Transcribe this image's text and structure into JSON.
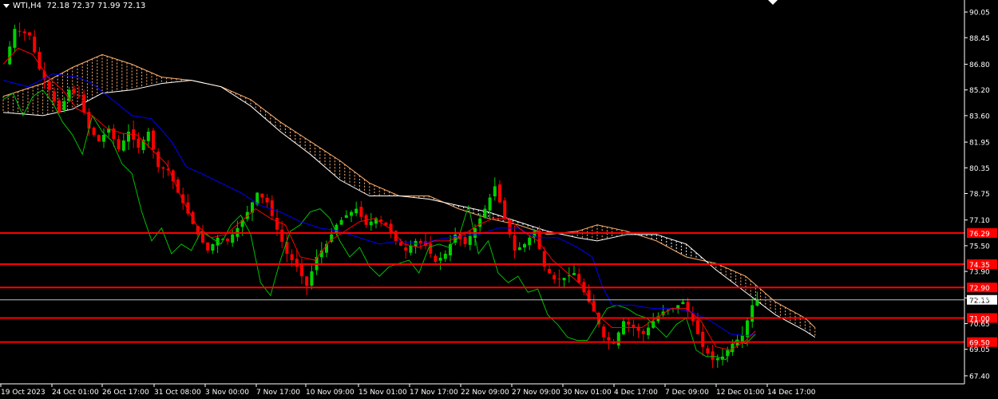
{
  "symbol": "WTI,H4",
  "ohlc": "72.18 72.37 71.99 72.13",
  "colors": {
    "background": "#000000",
    "bull": "#00d000",
    "bear": "#ff0000",
    "tenkan": "#ff0000",
    "kijun": "#0000ff",
    "chikou": "#00c000",
    "kumo_down": "#ffffff",
    "kumo_up": "#ffb070",
    "level": "#ff0000",
    "axis": "#ffffff",
    "price_line": "#c0c0c0"
  },
  "chart_data": {
    "type": "candlestick",
    "instrument": "WTI",
    "timeframe": "H4",
    "ylim": [
      66.9,
      90.6
    ],
    "y_ticks": [
      "90.05",
      "88.45",
      "86.80",
      "85.20",
      "83.60",
      "81.95",
      "80.35",
      "78.75",
      "77.10",
      "75.50",
      "73.90",
      "72.25",
      "70.65",
      "69.05",
      "67.40"
    ],
    "x_ticks": [
      "19 Oct 2023",
      "24 Oct 01:00",
      "26 Oct 17:00",
      "31 Oct 08:00",
      "3 Nov 00:00",
      "7 Nov 17:00",
      "10 Nov 09:00",
      "15 Nov 01:00",
      "17 Nov 17:00",
      "22 Nov 09:00",
      "27 Nov 09:00",
      "30 Nov 01:00",
      "4 Dec 17:00",
      "7 Dec 09:00",
      "12 Dec 01:00",
      "14 Dec 17:00"
    ],
    "price_path": [
      [
        0,
        86.8
      ],
      [
        2,
        89.0
      ],
      [
        5,
        88.6
      ],
      [
        7,
        86.5
      ],
      [
        9,
        85.2
      ],
      [
        11,
        83.8
      ],
      [
        13,
        85.2
      ],
      [
        15,
        84.8
      ],
      [
        17,
        82.8
      ],
      [
        19,
        82.0
      ],
      [
        21,
        82.8
      ],
      [
        23,
        81.5
      ],
      [
        25,
        82.6
      ],
      [
        27,
        81.6
      ],
      [
        29,
        82.6
      ],
      [
        31,
        80.4
      ],
      [
        33,
        80.2
      ],
      [
        35,
        78.8
      ],
      [
        37,
        77.5
      ],
      [
        39,
        76.2
      ],
      [
        41,
        75.2
      ],
      [
        43,
        76.0
      ],
      [
        45,
        75.8
      ],
      [
        47,
        76.6
      ],
      [
        49,
        77.6
      ],
      [
        51,
        78.8
      ],
      [
        53,
        78.2
      ],
      [
        55,
        76.5
      ],
      [
        57,
        75.0
      ],
      [
        59,
        74.2
      ],
      [
        61,
        73.0
      ],
      [
        63,
        74.8
      ],
      [
        65,
        75.6
      ],
      [
        67,
        76.8
      ],
      [
        69,
        77.4
      ],
      [
        71,
        77.8
      ],
      [
        73,
        76.8
      ],
      [
        75,
        77.2
      ],
      [
        77,
        76.8
      ],
      [
        79,
        75.8
      ],
      [
        81,
        75.2
      ],
      [
        83,
        75.8
      ],
      [
        85,
        75.5
      ],
      [
        87,
        74.5
      ],
      [
        89,
        75.0
      ],
      [
        91,
        76.2
      ],
      [
        93,
        75.6
      ],
      [
        95,
        76.6
      ],
      [
        97,
        77.8
      ],
      [
        99,
        79.2
      ],
      [
        101,
        77.2
      ],
      [
        103,
        75.2
      ],
      [
        105,
        75.6
      ],
      [
        107,
        76.4
      ],
      [
        109,
        74.2
      ],
      [
        111,
        73.4
      ],
      [
        113,
        73.5
      ],
      [
        115,
        73.8
      ],
      [
        117,
        72.6
      ],
      [
        119,
        71.4
      ],
      [
        121,
        69.8
      ],
      [
        123,
        69.4
      ],
      [
        125,
        70.8
      ],
      [
        127,
        70.4
      ],
      [
        129,
        70.0
      ],
      [
        131,
        70.8
      ],
      [
        133,
        71.4
      ],
      [
        135,
        71.6
      ],
      [
        137,
        72.0
      ],
      [
        139,
        70.8
      ],
      [
        141,
        69.2
      ],
      [
        143,
        68.4
      ],
      [
        145,
        68.6
      ],
      [
        147,
        69.4
      ],
      [
        149,
        69.9
      ],
      [
        151,
        71.8
      ],
      [
        152,
        72.13
      ]
    ],
    "tenkan": [
      [
        0,
        86.8
      ],
      [
        3,
        87.8
      ],
      [
        6,
        87.4
      ],
      [
        9,
        86.0
      ],
      [
        12,
        85.2
      ],
      [
        15,
        84.0
      ],
      [
        18,
        83.6
      ],
      [
        21,
        82.8
      ],
      [
        24,
        82.5
      ],
      [
        27,
        82.4
      ],
      [
        30,
        81.5
      ],
      [
        33,
        80.6
      ],
      [
        36,
        78.5
      ],
      [
        39,
        76.8
      ],
      [
        42,
        76.0
      ],
      [
        45,
        76.2
      ],
      [
        48,
        77.0
      ],
      [
        51,
        77.8
      ],
      [
        54,
        77.2
      ],
      [
        57,
        76.8
      ],
      [
        60,
        74.8
      ],
      [
        63,
        74.6
      ],
      [
        66,
        75.8
      ],
      [
        69,
        76.4
      ],
      [
        72,
        77.0
      ],
      [
        75,
        77.2
      ],
      [
        78,
        76.6
      ],
      [
        81,
        75.6
      ],
      [
        84,
        75.4
      ],
      [
        87,
        75.8
      ],
      [
        90,
        75.8
      ],
      [
        93,
        76.2
      ],
      [
        96,
        76.8
      ],
      [
        99,
        77.2
      ],
      [
        102,
        77.2
      ],
      [
        105,
        76.4
      ],
      [
        108,
        75.8
      ],
      [
        111,
        74.6
      ],
      [
        114,
        73.8
      ],
      [
        117,
        73.0
      ],
      [
        120,
        71.2
      ],
      [
        123,
        70.4
      ],
      [
        126,
        70.4
      ],
      [
        129,
        70.4
      ],
      [
        132,
        71.0
      ],
      [
        135,
        71.6
      ],
      [
        138,
        71.6
      ],
      [
        141,
        70.8
      ],
      [
        144,
        69.2
      ],
      [
        147,
        69.0
      ],
      [
        150,
        69.6
      ],
      [
        152,
        70.2
      ]
    ],
    "kijun": [
      [
        0,
        85.8
      ],
      [
        5,
        85.4
      ],
      [
        10,
        86.2
      ],
      [
        15,
        86.0
      ],
      [
        18,
        85.6
      ],
      [
        22,
        84.6
      ],
      [
        26,
        83.6
      ],
      [
        30,
        83.4
      ],
      [
        34,
        82.0
      ],
      [
        37,
        80.4
      ],
      [
        40,
        80.0
      ],
      [
        44,
        79.4
      ],
      [
        48,
        78.8
      ],
      [
        52,
        78.0
      ],
      [
        56,
        77.6
      ],
      [
        60,
        77.0
      ],
      [
        64,
        76.6
      ],
      [
        68,
        76.4
      ],
      [
        72,
        76.0
      ],
      [
        76,
        75.6
      ],
      [
        80,
        75.8
      ],
      [
        84,
        75.6
      ],
      [
        88,
        75.9
      ],
      [
        92,
        76.1
      ],
      [
        96,
        76.2
      ],
      [
        100,
        76.6
      ],
      [
        104,
        76.6
      ],
      [
        108,
        76.0
      ],
      [
        112,
        76.0
      ],
      [
        116,
        75.4
      ],
      [
        119,
        74.8
      ],
      [
        121,
        73.0
      ],
      [
        123,
        71.8
      ],
      [
        127,
        71.8
      ],
      [
        131,
        71.6
      ],
      [
        135,
        71.6
      ],
      [
        139,
        71.4
      ],
      [
        143,
        70.8
      ],
      [
        147,
        70.0
      ],
      [
        150,
        69.9
      ],
      [
        152,
        70.0
      ]
    ],
    "chikou": [
      [
        0,
        84.6
      ],
      [
        2,
        85.0
      ],
      [
        4,
        83.6
      ],
      [
        6,
        84.8
      ],
      [
        8,
        85.2
      ],
      [
        10,
        84.4
      ],
      [
        12,
        83.2
      ],
      [
        14,
        82.4
      ],
      [
        16,
        81.2
      ],
      [
        18,
        83.6
      ],
      [
        20,
        82.6
      ],
      [
        22,
        82.0
      ],
      [
        24,
        80.6
      ],
      [
        26,
        80.0
      ],
      [
        28,
        77.6
      ],
      [
        30,
        75.8
      ],
      [
        32,
        76.6
      ],
      [
        34,
        75.0
      ],
      [
        36,
        75.6
      ],
      [
        38,
        75.2
      ],
      [
        40,
        76.4
      ],
      [
        42,
        76.0
      ],
      [
        44,
        75.6
      ],
      [
        46,
        76.8
      ],
      [
        48,
        77.4
      ],
      [
        50,
        76.2
      ],
      [
        52,
        73.2
      ],
      [
        54,
        72.4
      ],
      [
        56,
        74.6
      ],
      [
        58,
        76.4
      ],
      [
        60,
        76.8
      ],
      [
        62,
        77.6
      ],
      [
        64,
        77.8
      ],
      [
        66,
        77.2
      ],
      [
        68,
        75.8
      ],
      [
        70,
        74.8
      ],
      [
        72,
        75.4
      ],
      [
        74,
        74.2
      ],
      [
        76,
        73.6
      ],
      [
        78,
        74.2
      ],
      [
        80,
        74.4
      ],
      [
        82,
        74.6
      ],
      [
        84,
        73.8
      ],
      [
        86,
        75.4
      ],
      [
        88,
        75.6
      ],
      [
        90,
        75.4
      ],
      [
        92,
        76.0
      ],
      [
        94,
        78.0
      ],
      [
        96,
        75.0
      ],
      [
        98,
        75.8
      ],
      [
        100,
        73.8
      ],
      [
        102,
        73.2
      ],
      [
        104,
        73.6
      ],
      [
        106,
        72.6
      ],
      [
        108,
        72.8
      ],
      [
        110,
        71.2
      ],
      [
        112,
        70.6
      ],
      [
        114,
        69.8
      ],
      [
        116,
        69.6
      ],
      [
        118,
        69.6
      ],
      [
        120,
        70.6
      ],
      [
        122,
        71.6
      ],
      [
        124,
        71.8
      ],
      [
        126,
        71.6
      ],
      [
        128,
        71.2
      ],
      [
        130,
        71.0
      ],
      [
        132,
        70.4
      ],
      [
        134,
        69.8
      ],
      [
        136,
        70.6
      ],
      [
        138,
        71.0
      ],
      [
        140,
        69.0
      ],
      [
        142,
        68.6
      ],
      [
        144,
        68.6
      ],
      [
        146,
        68.4
      ],
      [
        148,
        69.6
      ],
      [
        150,
        69.4
      ],
      [
        152,
        70.0
      ]
    ],
    "span_a": [
      [
        0,
        84.8
      ],
      [
        8,
        85.6
      ],
      [
        14,
        86.6
      ],
      [
        20,
        87.4
      ],
      [
        26,
        86.8
      ],
      [
        32,
        86.0
      ],
      [
        38,
        85.8
      ],
      [
        44,
        85.4
      ],
      [
        50,
        84.6
      ],
      [
        56,
        83.2
      ],
      [
        62,
        82.0
      ],
      [
        68,
        80.8
      ],
      [
        74,
        79.4
      ],
      [
        80,
        78.6
      ],
      [
        86,
        78.6
      ],
      [
        92,
        77.8
      ],
      [
        98,
        77.2
      ],
      [
        104,
        76.8
      ],
      [
        110,
        76.2
      ],
      [
        116,
        76.4
      ],
      [
        120,
        76.8
      ],
      [
        126,
        76.4
      ],
      [
        132,
        75.8
      ],
      [
        138,
        74.8
      ],
      [
        144,
        74.4
      ],
      [
        150,
        73.6
      ],
      [
        156,
        72.0
      ],
      [
        162,
        71.0
      ],
      [
        164,
        70.4
      ]
    ],
    "span_b": [
      [
        0,
        83.8
      ],
      [
        8,
        83.6
      ],
      [
        14,
        84.0
      ],
      [
        20,
        85.0
      ],
      [
        26,
        85.2
      ],
      [
        32,
        85.6
      ],
      [
        38,
        85.8
      ],
      [
        44,
        85.4
      ],
      [
        50,
        84.2
      ],
      [
        56,
        82.6
      ],
      [
        62,
        81.2
      ],
      [
        68,
        79.6
      ],
      [
        74,
        78.6
      ],
      [
        80,
        78.6
      ],
      [
        86,
        78.4
      ],
      [
        92,
        78.0
      ],
      [
        98,
        77.6
      ],
      [
        104,
        77.0
      ],
      [
        110,
        76.4
      ],
      [
        116,
        76.0
      ],
      [
        120,
        75.8
      ],
      [
        126,
        76.2
      ],
      [
        132,
        76.2
      ],
      [
        138,
        75.6
      ],
      [
        144,
        74.0
      ],
      [
        150,
        72.6
      ],
      [
        156,
        71.2
      ],
      [
        162,
        70.2
      ],
      [
        164,
        69.8
      ]
    ],
    "horizontal_levels": [
      {
        "price": 76.29,
        "label": "76.29"
      },
      {
        "price": 74.35,
        "label": "74.35"
      },
      {
        "price": 72.9,
        "label": "72.90"
      },
      {
        "price": 71.0,
        "label": "71.00"
      },
      {
        "price": 69.5,
        "label": "69.50"
      }
    ],
    "last_price": {
      "price": 72.13,
      "label": "72.13"
    }
  }
}
